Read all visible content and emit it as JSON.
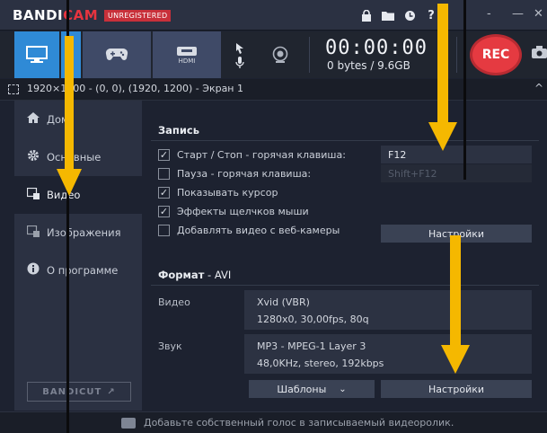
{
  "titlebar": {
    "brand_a": "BANDI",
    "brand_b": "C",
    "brand_c": "AM",
    "badge": "UNREGISTERED",
    "min_glyph": "-",
    "close_glyph": "✕"
  },
  "toolbar": {
    "hdmi_label": "HDMI",
    "timer": "00:00:00",
    "size": "0 bytes / 9.6GB",
    "rec_label": "REC"
  },
  "areabar": {
    "text": "1920×1200 - (0, 0), (1920, 1200) - Экран 1",
    "chevron": "^"
  },
  "sidebar": {
    "items": [
      {
        "label": "Дом"
      },
      {
        "label": "Основные"
      },
      {
        "label": "Видео"
      },
      {
        "label": "Изображения"
      },
      {
        "label": "О программе"
      }
    ],
    "bandicut": "BANDICUT",
    "bandicut_arrow": "↗"
  },
  "record": {
    "title": "Запись",
    "options": [
      {
        "label": "Старт / Стоп - горячая клавиша:",
        "checked": true
      },
      {
        "label": "Пауза - горячая клавиша:",
        "checked": false
      },
      {
        "label": "Показывать курсор",
        "checked": true
      },
      {
        "label": "Эффекты щелчков мыши",
        "checked": true
      },
      {
        "label": "Добавлять видео с веб-камеры",
        "checked": false
      }
    ],
    "hotkey_start": "F12",
    "hotkey_pause": "Shift+F12",
    "settings_button": "Настройки"
  },
  "format": {
    "title": "Формат",
    "container": " - AVI",
    "video_label": "Видео",
    "video_codec": "Xvid (VBR)",
    "video_details": "1280x0, 30,00fps, 80q",
    "audio_label": "Звук",
    "audio_codec": "MP3 - MPEG-1 Layer 3",
    "audio_details": "48,0KHz, stereo, 192kbps",
    "templates_button": "Шаблоны",
    "templates_chevron": "⌄",
    "settings_button": "Настройки"
  },
  "footer": {
    "text": "Добавьте собственный голос в записываемый видеоролик."
  },
  "colors": {
    "accent": "#2f8ad6",
    "rec": "#e53a41",
    "arrow": "#f5b800"
  }
}
